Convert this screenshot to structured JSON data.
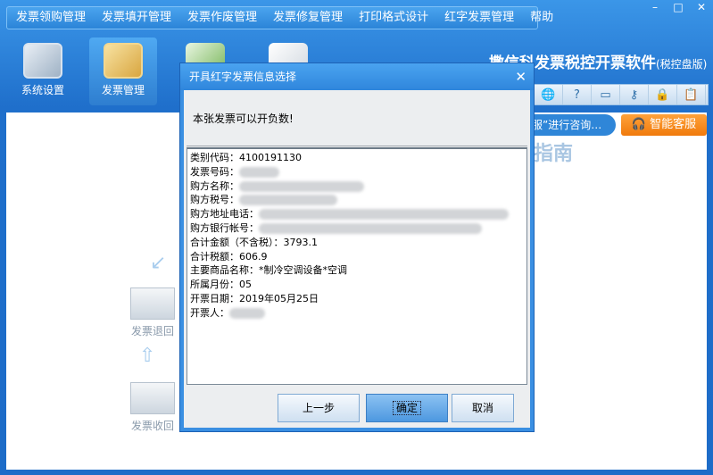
{
  "menu": [
    "发票领购管理",
    "发票填开管理",
    "发票作废管理",
    "发票修复管理",
    "打印格式设计",
    "红字发票管理",
    "帮助"
  ],
  "window_controls": {
    "minimize": "–",
    "maximize": "□",
    "close": "✕"
  },
  "toolbar": [
    {
      "label": "系统设置",
      "icon": "settings-icon"
    },
    {
      "label": "发票管理",
      "icon": "invoice-folder-icon"
    }
  ],
  "brand": {
    "title": "撒信科发票税控开票软件",
    "edition": "(税控盘版)"
  },
  "icon_row": [
    "globe-icon",
    "help-icon",
    "window-icon",
    "key-icon",
    "lock-icon",
    "clipboard-icon"
  ],
  "consult_text": "服”进行咨询…",
  "service_label": "智能客服",
  "guide_title": "指南",
  "flow": {
    "return": "发票退回",
    "receive": "发票收回"
  },
  "dialog": {
    "title": "开具红字发票信息选择",
    "close": "✕",
    "message": "本张发票可以开负数!",
    "fields": [
      {
        "label": "类别代码：",
        "value": "4100191130"
      },
      {
        "label": "发票号码：",
        "value": ""
      },
      {
        "label": "购方名称：",
        "value": ""
      },
      {
        "label": "购方税号：",
        "value": ""
      },
      {
        "label": "购方地址电话：",
        "value": ""
      },
      {
        "label": "购方银行帐号：",
        "value": ""
      },
      {
        "label": "合计金额（不含税）：",
        "value": "3793.1"
      },
      {
        "label": "合计税额：",
        "value": "606.9"
      },
      {
        "label": "主要商品名称：",
        "value": "*制冷空调设备*空调"
      },
      {
        "label": "所属月份：",
        "value": "05"
      },
      {
        "label": "开票日期：",
        "value": "2019年05月25日"
      },
      {
        "label": "开票人：",
        "value": ""
      }
    ],
    "buttons": {
      "prev": "上一步",
      "ok": "确定",
      "cancel": "取消"
    }
  }
}
